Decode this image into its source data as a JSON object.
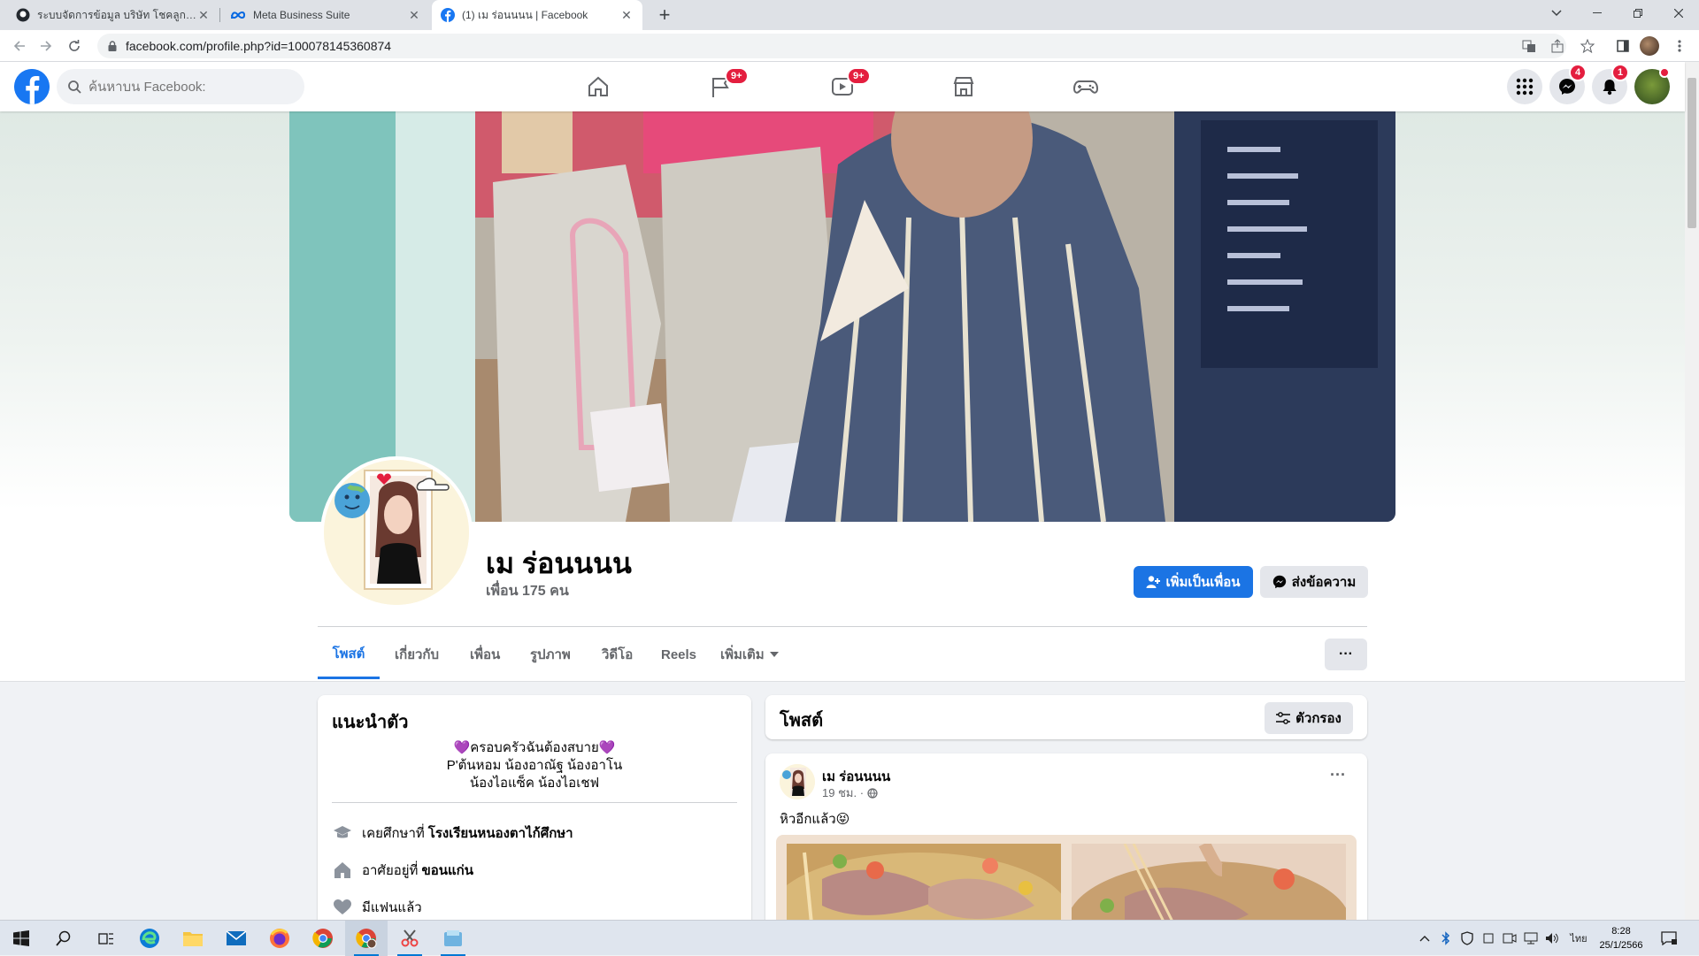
{
  "browser": {
    "tabs": [
      {
        "label": "ระบบจัดการข้อมูล บริษัท โชคลูกน็อต เ",
        "icon": "github-icon",
        "active": false
      },
      {
        "label": "Meta Business Suite",
        "icon": "meta-icon",
        "active": false
      },
      {
        "label": "(1) เม ร่อนนนน | Facebook",
        "icon": "facebook-icon",
        "active": true
      }
    ],
    "new_tab": "+",
    "url": "facebook.com/profile.php?id=100078145360874"
  },
  "fb_header": {
    "search_placeholder": "ค้นหาบน Facebook:",
    "nav_badges": {
      "pages": "9+",
      "watch": "9+"
    },
    "right_badges": {
      "messenger": "4",
      "notifications": "1"
    }
  },
  "profile": {
    "name": "เม ร่อนนนน",
    "friends": "เพื่อน 175 คน",
    "add_friend": "เพิ่มเป็นเพื่อน",
    "message": "ส่งข้อความ",
    "tabs": [
      "โพสต์",
      "เกี่ยวกับ",
      "เพื่อน",
      "รูปภาพ",
      "วิดีโอ",
      "Reels",
      "เพิ่มเติม"
    ],
    "more": "···"
  },
  "intro": {
    "title": "แนะนำตัว",
    "bio_lines": [
      "💜ครอบครัวฉันต้องสบาย💜",
      "P'ต้นหอม น้องอาณัฐ น้องอาโน",
      "น้องไอแซ็ค น้องไอเชฟ"
    ],
    "education_prefix": "เคยศึกษาที่ ",
    "education": "โรงเรียนหนองตาไก้ศึกษา",
    "lives_prefix": "อาศัยอยู่ที่ ",
    "lives": "ขอนแก่น",
    "relationship": "มีแฟนแล้ว"
  },
  "posts": {
    "title": "โพสต์",
    "filter": "ตัวกรอง",
    "item": {
      "author": "เม ร่อนนนน",
      "time": "19 ชม. ·",
      "text": "หิวอีกแล้ว😝",
      "menu": "···"
    }
  },
  "taskbar": {
    "lang": "ไทย",
    "time": "8:28",
    "date": "25/1/2566"
  },
  "colors": {
    "fb_blue": "#1877f2",
    "button_blue": "#1b74e4",
    "badge_red": "#e41e3f"
  }
}
